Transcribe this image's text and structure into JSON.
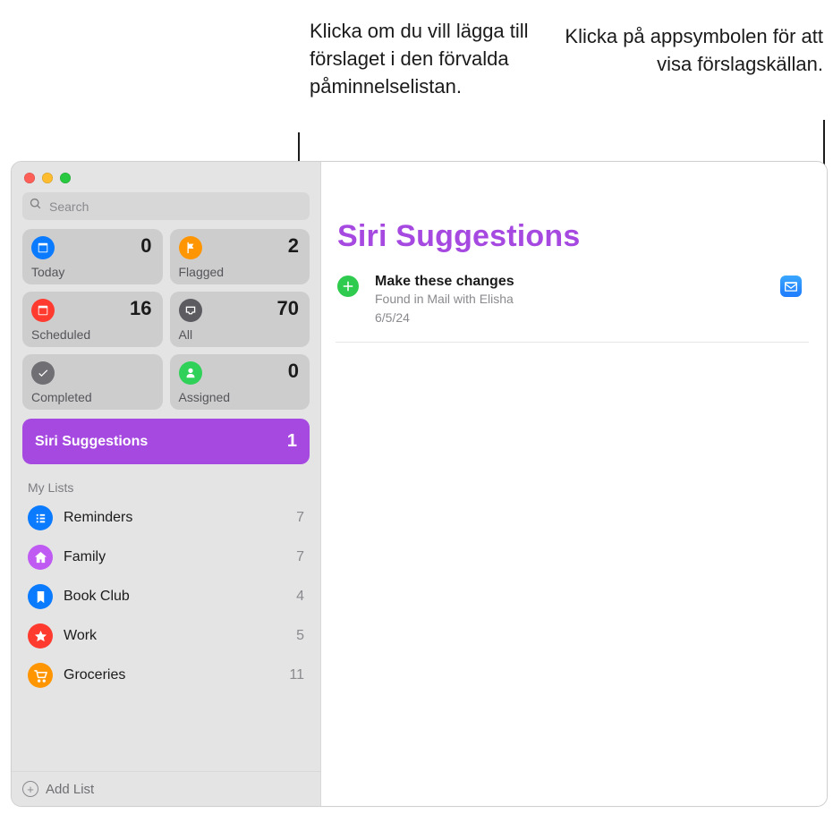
{
  "callouts": {
    "left": "Klicka om du vill lägga till förslaget i den förvalda påminnelselistan.",
    "right": "Klicka på appsymbolen för att visa förslagskällan."
  },
  "search": {
    "placeholder": "Search"
  },
  "smart_lists": {
    "today": {
      "label": "Today",
      "count": "0",
      "color": "#0A7BFF",
      "icon": "calendar"
    },
    "flagged": {
      "label": "Flagged",
      "count": "2",
      "color": "#FF9500",
      "icon": "flag"
    },
    "scheduled": {
      "label": "Scheduled",
      "count": "16",
      "color": "#FF3B30",
      "icon": "calendar"
    },
    "all": {
      "label": "All",
      "count": "70",
      "color": "#5B5B60",
      "icon": "tray"
    },
    "completed": {
      "label": "Completed",
      "count": "",
      "color": "#6F6F74",
      "icon": "check"
    },
    "assigned": {
      "label": "Assigned",
      "count": "0",
      "color": "#30D158",
      "icon": "person"
    }
  },
  "siri_row": {
    "label": "Siri Suggestions",
    "count": "1"
  },
  "lists_header": "My Lists",
  "lists": [
    {
      "name": "Reminders",
      "count": "7",
      "color": "#0A7BFF",
      "icon": "list"
    },
    {
      "name": "Family",
      "count": "7",
      "color": "#BF5AF2",
      "icon": "house"
    },
    {
      "name": "Book Club",
      "count": "4",
      "color": "#0A7BFF",
      "icon": "bookmark"
    },
    {
      "name": "Work",
      "count": "5",
      "color": "#FF3B30",
      "icon": "star"
    },
    {
      "name": "Groceries",
      "count": "11",
      "color": "#FF9500",
      "icon": "cart"
    }
  ],
  "add_list_label": "Add List",
  "main": {
    "title": "Siri Suggestions",
    "suggestion": {
      "title": "Make these changes",
      "source": "Found in Mail with Elisha",
      "date": "6/5/24"
    }
  }
}
